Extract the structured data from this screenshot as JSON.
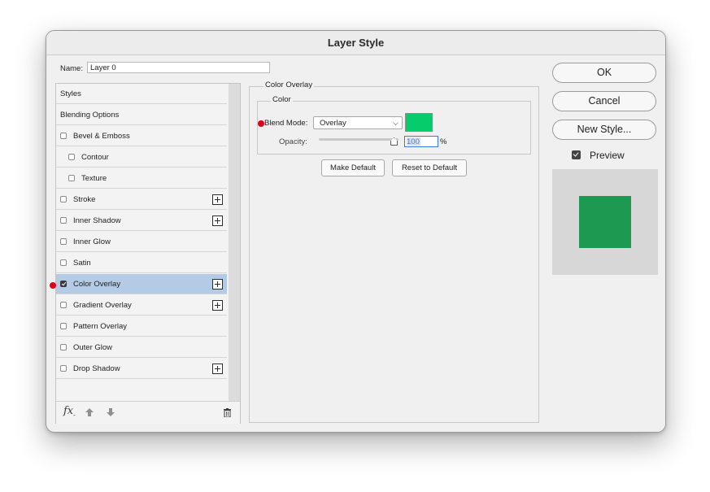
{
  "window": {
    "title": "Layer Style"
  },
  "name_field": {
    "label": "Name:",
    "value": "Layer 0"
  },
  "styles_list": [
    {
      "label": "Styles",
      "indent": 0,
      "has_checkbox": false,
      "checked": false,
      "has_plus": false,
      "selected": false
    },
    {
      "label": "Blending Options",
      "indent": 0,
      "has_checkbox": false,
      "checked": false,
      "has_plus": false,
      "selected": false
    },
    {
      "label": "Bevel & Emboss",
      "indent": 0,
      "has_checkbox": true,
      "checked": false,
      "has_plus": false,
      "selected": false
    },
    {
      "label": "Contour",
      "indent": 1,
      "has_checkbox": true,
      "checked": false,
      "has_plus": false,
      "selected": false
    },
    {
      "label": "Texture",
      "indent": 1,
      "has_checkbox": true,
      "checked": false,
      "has_plus": false,
      "selected": false
    },
    {
      "label": "Stroke",
      "indent": 0,
      "has_checkbox": true,
      "checked": false,
      "has_plus": true,
      "selected": false
    },
    {
      "label": "Inner Shadow",
      "indent": 0,
      "has_checkbox": true,
      "checked": false,
      "has_plus": true,
      "selected": false
    },
    {
      "label": "Inner Glow",
      "indent": 0,
      "has_checkbox": true,
      "checked": false,
      "has_plus": false,
      "selected": false
    },
    {
      "label": "Satin",
      "indent": 0,
      "has_checkbox": true,
      "checked": false,
      "has_plus": false,
      "selected": false
    },
    {
      "label": "Color Overlay",
      "indent": 0,
      "has_checkbox": true,
      "checked": true,
      "has_plus": true,
      "selected": true
    },
    {
      "label": "Gradient Overlay",
      "indent": 0,
      "has_checkbox": true,
      "checked": false,
      "has_plus": true,
      "selected": false
    },
    {
      "label": "Pattern Overlay",
      "indent": 0,
      "has_checkbox": true,
      "checked": false,
      "has_plus": false,
      "selected": false
    },
    {
      "label": "Outer Glow",
      "indent": 0,
      "has_checkbox": true,
      "checked": false,
      "has_plus": false,
      "selected": false
    },
    {
      "label": "Drop Shadow",
      "indent": 0,
      "has_checkbox": true,
      "checked": false,
      "has_plus": true,
      "selected": false
    }
  ],
  "list_footer": {
    "fx_label": "fx",
    "icons": [
      "fx-icon",
      "move-up-icon",
      "move-down-icon",
      "trash-icon"
    ]
  },
  "color_overlay": {
    "section_title": "Color Overlay",
    "group_title": "Color",
    "blend_mode_label": "Blend Mode:",
    "blend_mode_value": "Overlay",
    "blend_mode_chevron": "⌵",
    "swatch_color": "#06cc6c",
    "opacity_label": "Opacity:",
    "opacity_value": "100",
    "opacity_unit": "%",
    "opacity_level": 1.0
  },
  "buttons": {
    "make_default": "Make Default",
    "reset_to_default": "Reset to Default",
    "ok": "OK",
    "cancel": "Cancel",
    "new_style": "New Style..."
  },
  "preview": {
    "label": "Preview",
    "checked": true,
    "result_color": "#1d9952"
  },
  "colors": {
    "selection": "#b3cbe5",
    "marker": "#e0001a",
    "focus": "#3b78d8"
  }
}
